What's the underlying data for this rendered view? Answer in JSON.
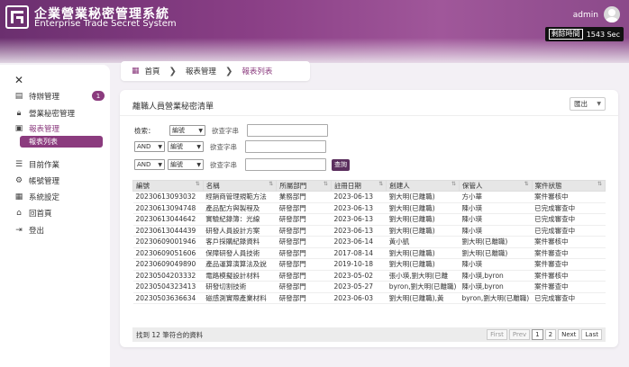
{
  "header": {
    "title": "企業營業秘密管理系統",
    "subtitle": "Enterprise Trade Secret System",
    "user": "admin",
    "timer_label": "剩餘時間",
    "timer_value": "1543 Sec"
  },
  "sidebar": {
    "items": [
      {
        "label": "待辦管理",
        "badge": "1"
      },
      {
        "label": "營業秘密管理"
      },
      {
        "label": "報表管理"
      },
      {
        "label": "報表列表"
      },
      {
        "label": "目前作業"
      },
      {
        "label": "帳號管理"
      },
      {
        "label": "系統設定"
      },
      {
        "label": "回首頁"
      },
      {
        "label": "登出"
      }
    ]
  },
  "breadcrumb": {
    "home": "首頁",
    "level1": "報表管理",
    "current": "報表列表"
  },
  "card": {
    "title": "離職人員營業秘密清單",
    "export_label": "匯出"
  },
  "filters": {
    "row1": {
      "label": "檢索：",
      "field": "編號",
      "placeholder": "欲查字串"
    },
    "row2": {
      "logic": "AND",
      "field": "編號",
      "placeholder": "欲查字串"
    },
    "row3": {
      "logic": "AND",
      "field": "編號",
      "placeholder": "欲查字串"
    },
    "query_label": "查詢"
  },
  "table": {
    "columns": [
      "編號",
      "名稱",
      "所屬部門",
      "註冊日期",
      "創建人",
      "保管人",
      "案件狀態"
    ],
    "rows": [
      [
        "20230613093032",
        "經銷商管理規範方法",
        "業務部門",
        "2023-06-13",
        "劉大明(已離職)",
        "方小華",
        "案件審核中"
      ],
      [
        "20230613094748",
        "產品配方與製程及",
        "研發部門",
        "2023-06-13",
        "劉大明(已離職)",
        "陳小瑛",
        "已完成審查中"
      ],
      [
        "20230613044642",
        "實驗紀錄簿：光線",
        "研發部門",
        "2023-06-13",
        "劉大明(已離職)",
        "陳小瑛",
        "已完成審查中"
      ],
      [
        "20230613044439",
        "研發人員設計方案",
        "研發部門",
        "2023-06-13",
        "劉大明(已離職)",
        "陳小瑛",
        "已完成審查中"
      ],
      [
        "20230609001946",
        "客戶採購紀錄資料",
        "研發部門",
        "2023-06-14",
        "黃小凱",
        "劉大明(已離職)",
        "案件審核中"
      ],
      [
        "20230609051606",
        "保障研發人員技術",
        "研發部門",
        "2017-08-14",
        "劉大明(已離職)",
        "劉大明(已離職)",
        "案件審查中"
      ],
      [
        "20230609049890",
        "產品運算演算法及說",
        "研發部門",
        "2019-10-18",
        "劉大明(已離職)",
        "陳小瑛",
        "案件審查中"
      ],
      [
        "20230504203332",
        "電路模擬設計材料",
        "研發部門",
        "2023-05-02",
        "張小瑛,劉大明(已離",
        "陳小瑛,byron",
        "案件審核中"
      ],
      [
        "20230504323413",
        "研發切割技術",
        "研發部門",
        "2023-05-27",
        "byron,劉大明(已離職)",
        "陳小瑛,byron",
        "案件審查中"
      ],
      [
        "20230503636634",
        "磁感測實際產業材料",
        "研發部門",
        "2023-06-03",
        "劉大明(已離職),黃",
        "byron,劉大明(已離職)",
        "已完成審查中"
      ]
    ],
    "footer_text": "找到 12 筆符合的資料",
    "pager": {
      "first": "First",
      "prev": "Prev",
      "page1": "1",
      "page2": "2",
      "next": "Next",
      "last": "Last"
    }
  }
}
